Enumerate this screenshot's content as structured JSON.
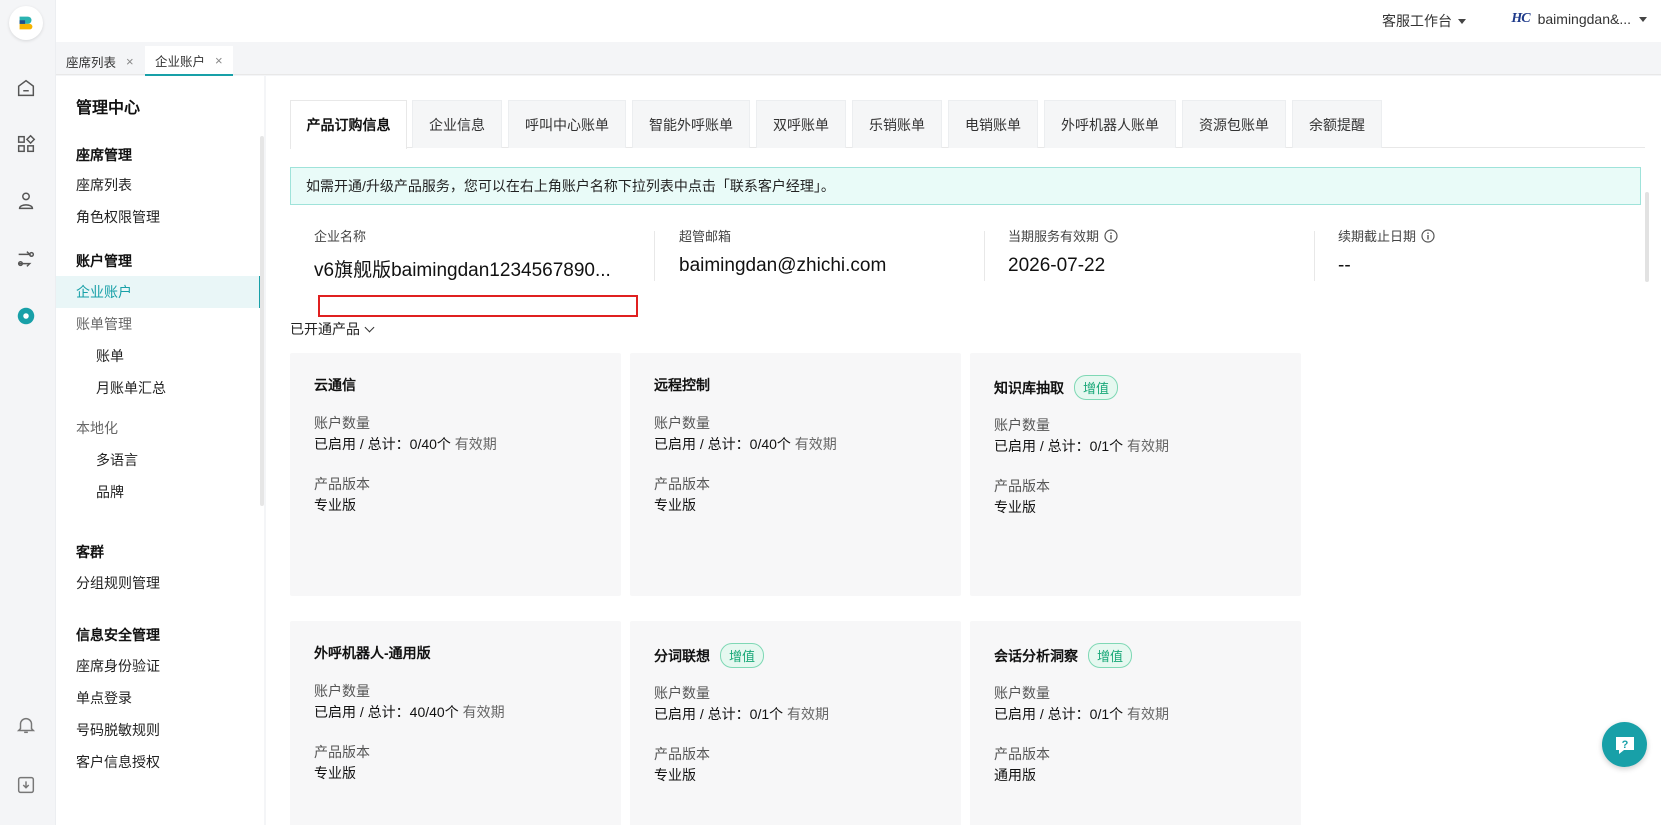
{
  "header": {
    "workbench_label": "客服工作台",
    "account_brand": "HC",
    "account_name": "baimingdan&..."
  },
  "page_tabs": [
    {
      "label": "座席列表",
      "close": "×"
    },
    {
      "label": "企业账户",
      "close": "×"
    }
  ],
  "sidebar": {
    "title": "管理中心",
    "groups": {
      "seat": "座席管理",
      "account": "账户管理",
      "customer_group": "客群",
      "security": "信息安全管理"
    },
    "items": {
      "seat_list": "座席列表",
      "role_perm": "角色权限管理",
      "enterprise_account": "企业账户",
      "bill_mgmt": "账单管理",
      "bill": "账单",
      "monthly_summary": "月账单汇总",
      "localization": "本地化",
      "multilang": "多语言",
      "brand": "品牌",
      "group_rules": "分组规则管理",
      "seat_identity": "座席身份验证",
      "sso": "单点登录",
      "number_mask": "号码脱敏规则",
      "customer_auth": "客户信息授权"
    }
  },
  "tabs": [
    "产品订购信息",
    "企业信息",
    "呼叫中心账单",
    "智能外呼账单",
    "双呼账单",
    "乐销账单",
    "电销账单",
    "外呼机器人账单",
    "资源包账单",
    "余额提醒"
  ],
  "notice": "如需开通/升级产品服务，您可以在右上角账户名称下拉列表中点击「联系客户经理」。",
  "info": {
    "company_label": "企业名称",
    "company_value": "v6旗舰版baimingdan1234567890...",
    "email_label": "超管邮箱",
    "email_value": "baimingdan@zhichi.com",
    "service_label": "当期服务有效期",
    "service_value": "2026-07-22",
    "renew_label": "续期截止日期",
    "renew_value": "--"
  },
  "opened_label": "已开通产品",
  "cards": [
    {
      "name": "云通信",
      "badge": "",
      "k1": "账户数量",
      "v1": "已启用 / 总计：0/40个",
      "v1_dim": " 有效期",
      "k2": "产品版本",
      "v2": "专业版"
    },
    {
      "name": "远程控制",
      "badge": "",
      "k1": "账户数量",
      "v1": "已启用 / 总计：0/40个",
      "v1_dim": " 有效期",
      "k2": "产品版本",
      "v2": "专业版"
    },
    {
      "name": "知识库抽取",
      "badge": "增值",
      "k1": "账户数量",
      "v1": "已启用 / 总计：0/1个",
      "v1_dim": " 有效期",
      "k2": "产品版本",
      "v2": "专业版"
    },
    {
      "name": "外呼机器人-通用版",
      "badge": "",
      "k1": "账户数量",
      "v1": "已启用 / 总计：40/40个",
      "v1_dim": " 有效期",
      "k2": "产品版本",
      "v2": "专业版"
    },
    {
      "name": "分词联想",
      "badge": "增值",
      "k1": "账户数量",
      "v1": "已启用 / 总计：0/1个",
      "v1_dim": " 有效期",
      "k2": "产品版本",
      "v2": "专业版"
    },
    {
      "name": "会话分析洞察",
      "badge": "增值",
      "k1": "账户数量",
      "v1": "已启用 / 总计：0/1个",
      "v1_dim": " 有效期",
      "k2": "产品版本",
      "v2": "通用版"
    }
  ],
  "colors": {
    "accent": "#18a0a8",
    "badge_green": "#18a878",
    "notice_bg": "#e9fbf8",
    "highlight_border": "#e02020"
  }
}
